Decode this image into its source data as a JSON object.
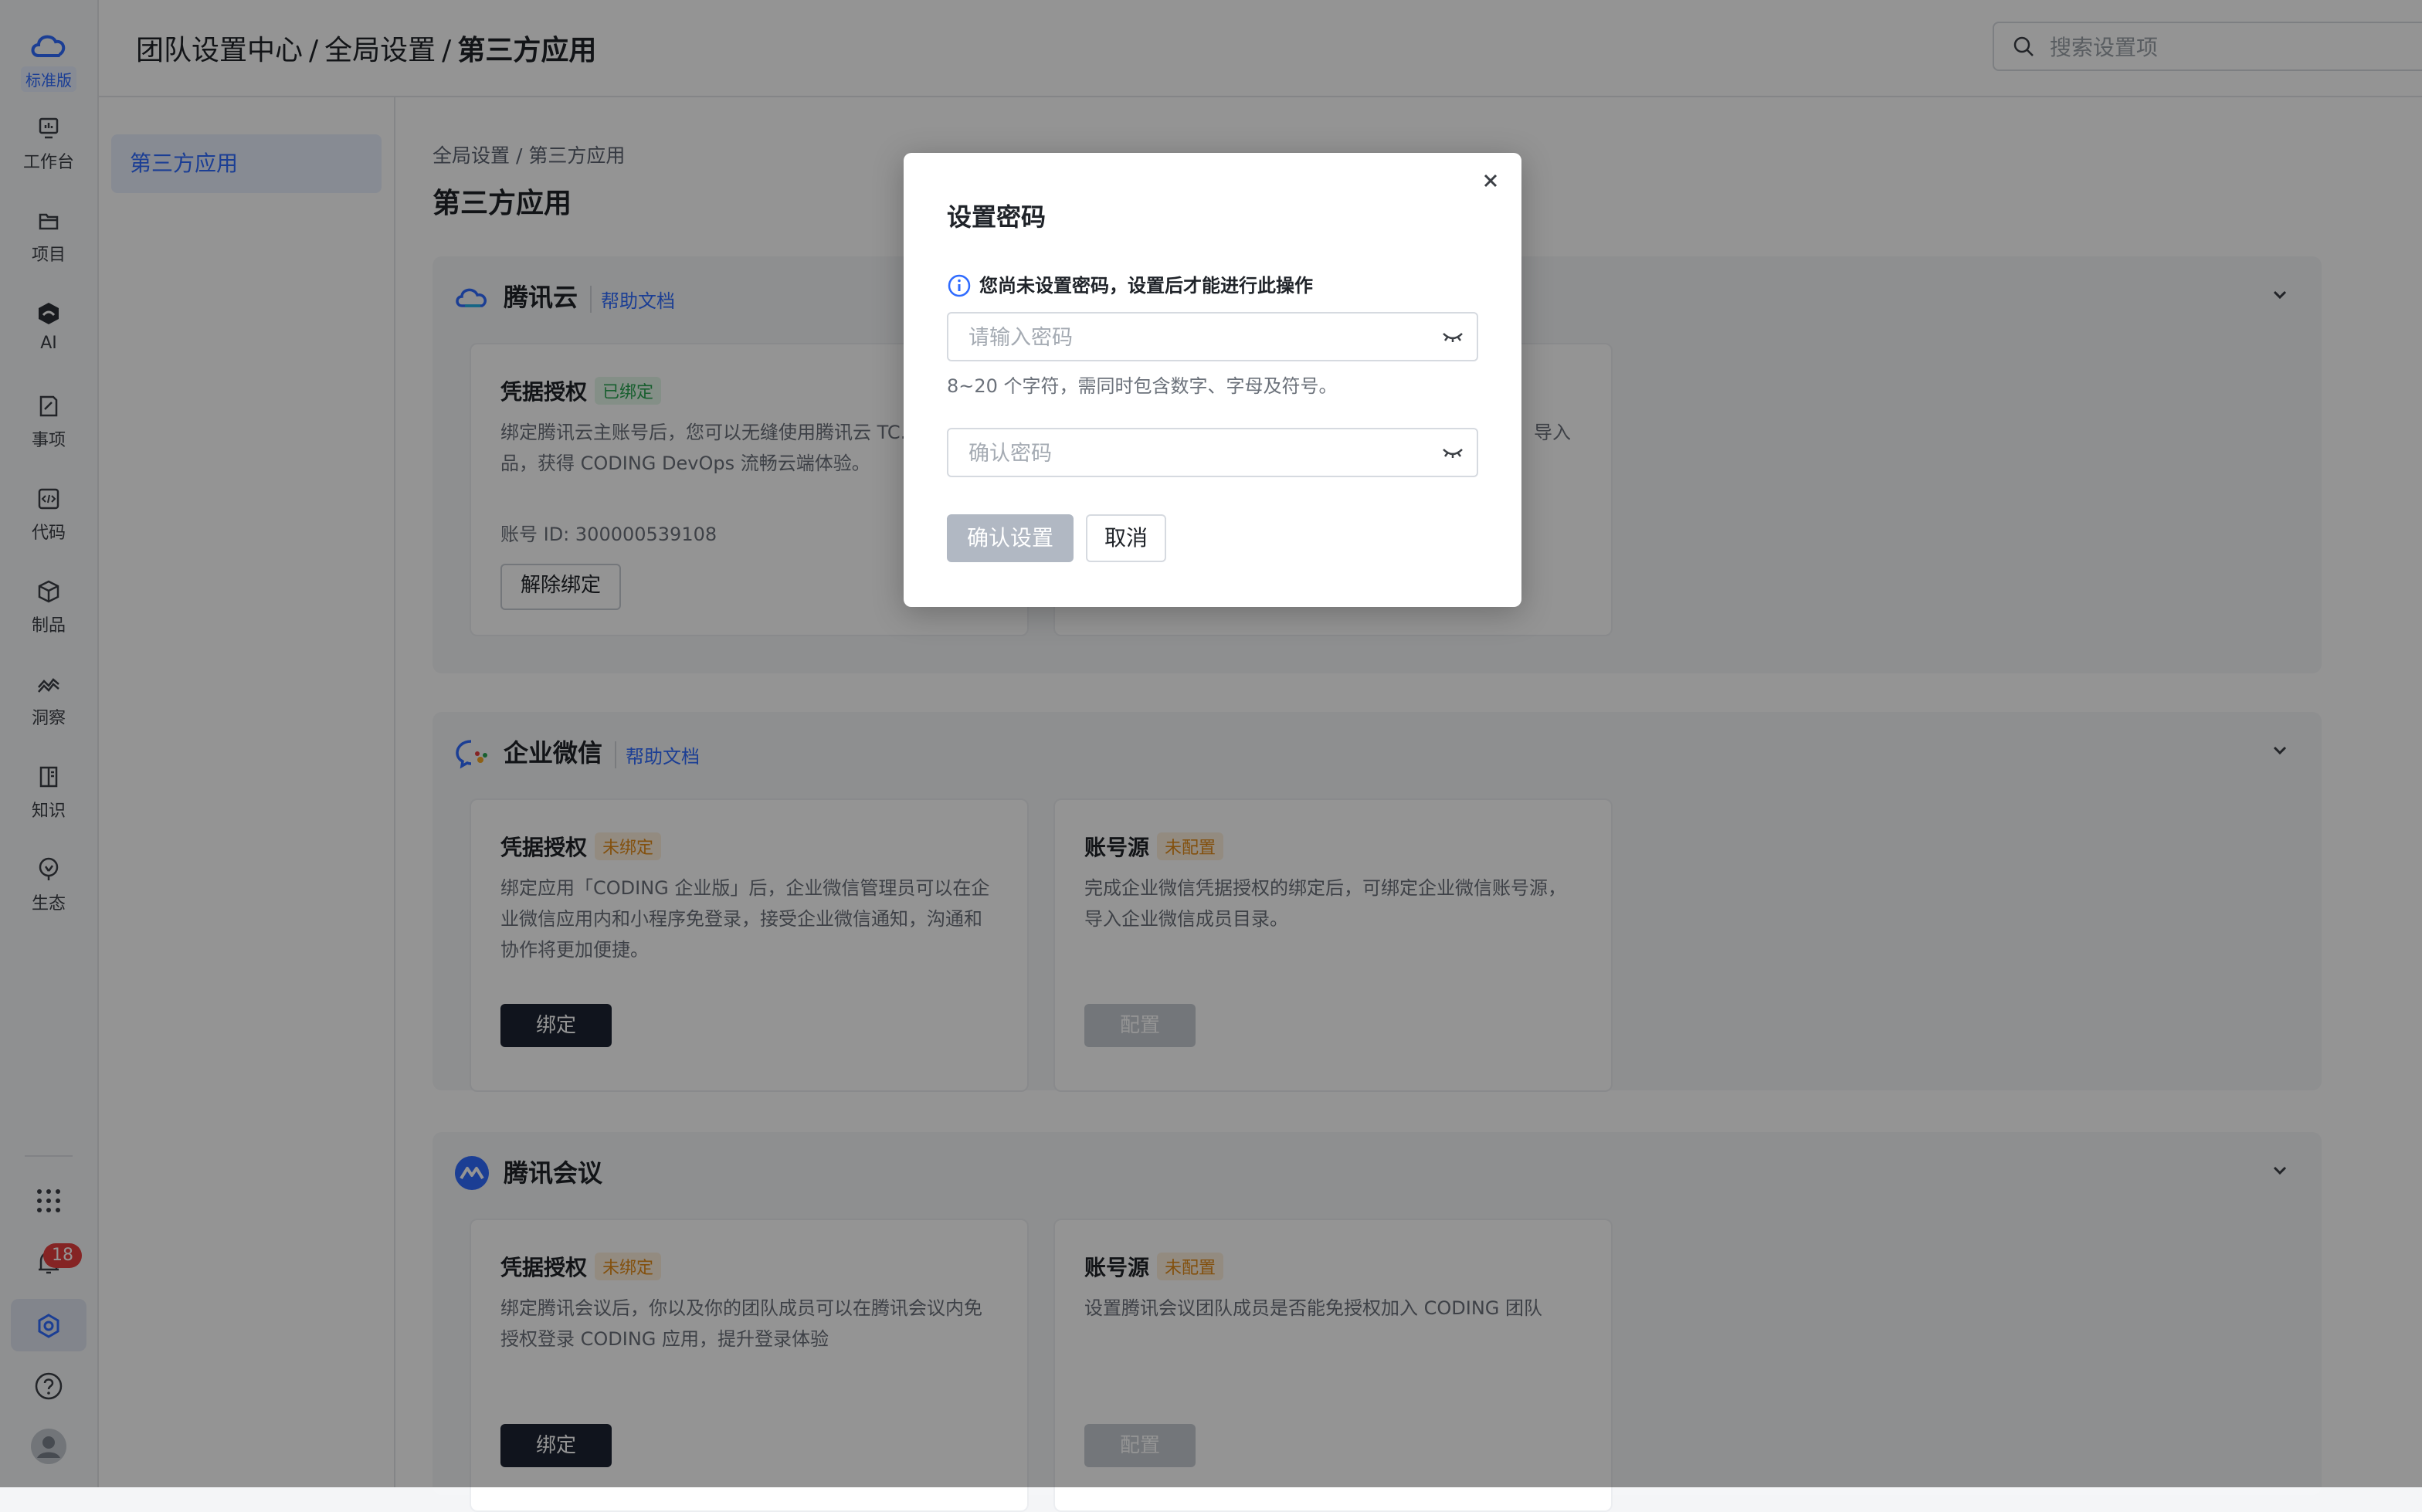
{
  "nav": {
    "edition": "标准版",
    "items": [
      {
        "label": "工作台",
        "icon": "dashboard-icon"
      },
      {
        "label": "项目",
        "icon": "folder-icon"
      },
      {
        "label": "AI",
        "icon": "ai-icon"
      },
      {
        "label": "事项",
        "icon": "issue-icon"
      },
      {
        "label": "代码",
        "icon": "code-icon"
      },
      {
        "label": "制品",
        "icon": "package-icon"
      },
      {
        "label": "洞察",
        "icon": "insight-icon"
      },
      {
        "label": "知识",
        "icon": "book-icon"
      },
      {
        "label": "生态",
        "icon": "ecosystem-icon"
      }
    ],
    "notification_count": "18"
  },
  "header": {
    "crumb1": "团队设置中心",
    "crumb2": "全局设置",
    "crumb3": "第三方应用",
    "separator": "/",
    "search_placeholder": "搜索设置项"
  },
  "subnav": {
    "active_item": "第三方应用"
  },
  "main": {
    "breadcrumb_1": "全局设置",
    "breadcrumb_sep": "/",
    "breadcrumb_2": "第三方应用",
    "title": "第三方应用"
  },
  "sections": {
    "tencent_cloud": {
      "name": "腾讯云",
      "help": "帮助文档",
      "card1": {
        "title": "凭据授权",
        "tag": "已绑定",
        "desc": "绑定腾讯云主账号后，您可以无缝使用腾讯云 TC… 云产品，获得 CODING DevOps 流畅云端体验。",
        "account": "账号 ID: 300000539108",
        "button": "解除绑定"
      },
      "card2": {
        "desc_tail": "导入"
      }
    },
    "wecom": {
      "name": "企业微信",
      "help": "帮助文档",
      "card1": {
        "title": "凭据授权",
        "tag": "未绑定",
        "desc": "绑定应用「CODING 企业版」后，企业微信管理员可以在企业微信应用内和小程序免登录，接受企业微信通知，沟通和协作将更加便捷。",
        "button": "绑定"
      },
      "card2": {
        "title": "账号源",
        "tag": "未配置",
        "desc": "完成企业微信凭据授权的绑定后，可绑定企业微信账号源，导入企业微信成员目录。",
        "button": "配置"
      }
    },
    "tencent_meeting": {
      "name": "腾讯会议",
      "card1": {
        "title": "凭据授权",
        "tag": "未绑定",
        "desc": "绑定腾讯会议后，你以及你的团队成员可以在腾讯会议内免授权登录 CODING 应用，提升登录体验",
        "button": "绑定"
      },
      "card2": {
        "title": "账号源",
        "tag": "未配置",
        "desc": "设置腾讯会议团队成员是否能免授权加入 CODING 团队",
        "button": "配置"
      }
    }
  },
  "modal": {
    "title": "设置密码",
    "notice": "您尚未设置密码，设置后才能进行此操作",
    "password_placeholder": "请输入密码",
    "password_value": "",
    "hint": "8~20 个字符，需同时包含数字、字母及符号。",
    "confirm_placeholder": "确认密码",
    "confirm_value": "",
    "confirm_button": "确认设置",
    "cancel_button": "取消"
  },
  "colors": {
    "accent": "#2f6bff",
    "success": "#2aa451",
    "warning": "#e28a18",
    "dark_button": "#1c2433"
  }
}
